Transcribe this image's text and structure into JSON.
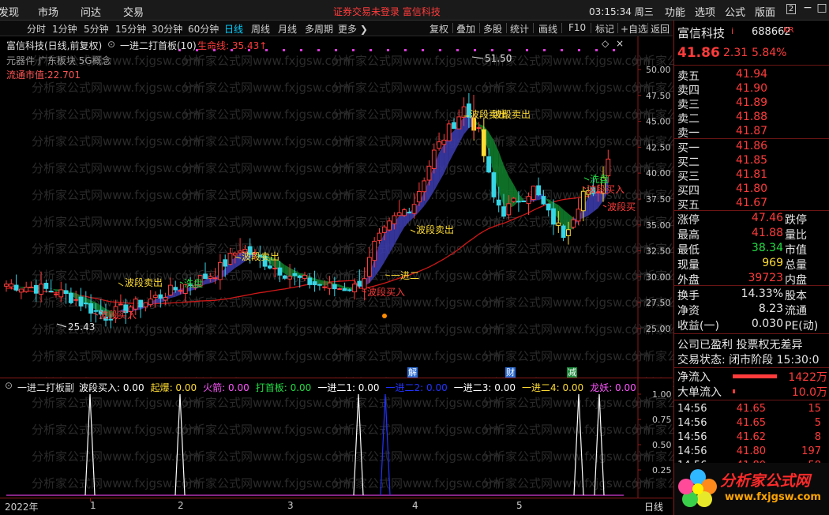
{
  "topbar": {
    "menu": [
      "发现",
      "市场",
      "问达",
      "交易"
    ],
    "notice": "证券交易未登录  富信科技",
    "clock": "03:15:34 周三",
    "right_menu": [
      "功能",
      "选项",
      "公式",
      "版面"
    ],
    "win_btn_num": "2"
  },
  "periods": [
    "分时",
    "1分钟",
    "5分钟",
    "15分钟",
    "30分钟",
    "60分钟",
    "日线",
    "周线",
    "月线",
    "多周期",
    "更多"
  ],
  "active_period": "日线",
  "toolbar": [
    "复权",
    "叠加",
    "多股",
    "统计",
    "画线",
    "F10",
    "标记",
    "+自选",
    "返回"
  ],
  "chart_header": {
    "title": "富信科技(日线,前复权)",
    "indicator": "一进二打首板(10)",
    "lifeline_label": "生命线: 35.43",
    "concepts": "元器件 广东板块 5G概念",
    "float_cap": "流通市值:22.701"
  },
  "price_axis": [
    "50.00",
    "47.50",
    "45.00",
    "42.50",
    "40.00",
    "37.50",
    "35.00",
    "32.50",
    "30.00",
    "27.50",
    "25.00"
  ],
  "annotations": {
    "high": "51.50",
    "low": "25.43",
    "wave_sell_1": "波段卖出",
    "wave_sell_2": "波段卖出",
    "wave_sell_3": "波段卖出",
    "wave_sell_4": "波段卖出",
    "wave_buy_1": "波段买入",
    "wave_buy_2": "波段买入",
    "wave_buy_3": "波段买入",
    "wave_buy_4": "波段买",
    "wash_1": "洗盘",
    "wash_2": "洗盘",
    "jin_er": "一进二"
  },
  "sub_header": {
    "name": "一进二打板副",
    "items": [
      {
        "label": "波段买入: 0.00",
        "color": "#ffffff"
      },
      {
        "label": "起爆: 0.00",
        "color": "#ffdd33"
      },
      {
        "label": "火箭: 0.00",
        "color": "#ff55ff"
      },
      {
        "label": "打首板: 0.00",
        "color": "#22dd44"
      },
      {
        "label": "一进二1: 0.00",
        "color": "#ffffff"
      },
      {
        "label": "一进二2: 0.00",
        "color": "#2233ff"
      },
      {
        "label": "一进二3: 0.00",
        "color": "#ffffff"
      },
      {
        "label": "一进二4: 0.00",
        "color": "#ffdd33"
      },
      {
        "label": "龙妖: 0.00",
        "color": "#ff55ff"
      }
    ],
    "badges": [
      "解",
      "财",
      "减"
    ]
  },
  "sub_axis": [
    "1.00",
    "0.75",
    "0.50",
    "0.25"
  ],
  "dates": [
    "2022年",
    "1",
    "2",
    "3",
    "4",
    "5"
  ],
  "date_mode": "日线",
  "quote": {
    "name": "富信科技",
    "tag": "i",
    "code": "688662",
    "suffix": "KR",
    "price": "41.86",
    "change": "2.31",
    "pct": "5.84%",
    "asks": [
      {
        "label": "卖五",
        "price": "41.94"
      },
      {
        "label": "卖四",
        "price": "41.90"
      },
      {
        "label": "卖三",
        "price": "41.89"
      },
      {
        "label": "卖二",
        "price": "41.88"
      },
      {
        "label": "卖一",
        "price": "41.87"
      }
    ],
    "bids": [
      {
        "label": "买一",
        "price": "41.86"
      },
      {
        "label": "买二",
        "price": "41.85"
      },
      {
        "label": "买三",
        "price": "41.81"
      },
      {
        "label": "买四",
        "price": "41.80"
      },
      {
        "label": "买五",
        "price": "41.67"
      }
    ],
    "stats": [
      {
        "l1": "涨停",
        "v1": "47.46",
        "c1": "red",
        "l2": "跌停"
      },
      {
        "l1": "最高",
        "v1": "41.88",
        "c1": "red",
        "l2": "量比"
      },
      {
        "l1": "最低",
        "v1": "38.34",
        "c1": "green",
        "l2": "市值"
      },
      {
        "l1": "现量",
        "v1": "969",
        "c1": "yellow",
        "l2": "总量"
      },
      {
        "l1": "外盘",
        "v1": "39723",
        "c1": "red",
        "l2": "内盘"
      }
    ],
    "stats2": [
      {
        "l1": "换手",
        "v1": "14.33%",
        "l2": "股本"
      },
      {
        "l1": "净资",
        "v1": "8.23",
        "l2": "流通"
      },
      {
        "l1": "收益(一)",
        "v1": "0.030",
        "l2": "PE(动)"
      }
    ],
    "status1": "公司已盈利 投票权无差异",
    "status2": "交易状态: 闭市阶段 15:30:0",
    "netflow_label": "净流入",
    "netflow_val": "1422万",
    "bigflow_label": "大单流入",
    "bigflow_val": "10.0万",
    "ticks": [
      {
        "t": "14:56",
        "p": "41.65",
        "v": "15",
        "c": "red"
      },
      {
        "t": "14:56",
        "p": "41.65",
        "v": "5",
        "c": "red"
      },
      {
        "t": "14:56",
        "p": "41.62",
        "v": "8",
        "c": "red"
      },
      {
        "t": "14:56",
        "p": "41.80",
        "v": "197",
        "c": "red"
      },
      {
        "t": "14:56",
        "p": "41.80",
        "v": "58",
        "c": "red"
      }
    ]
  },
  "watermark": "分析家公式网",
  "watermark_url": "www.fxjgsw.com",
  "logo_text": "分析家公式网",
  "logo_url": "www.fxjgsw.com"
}
